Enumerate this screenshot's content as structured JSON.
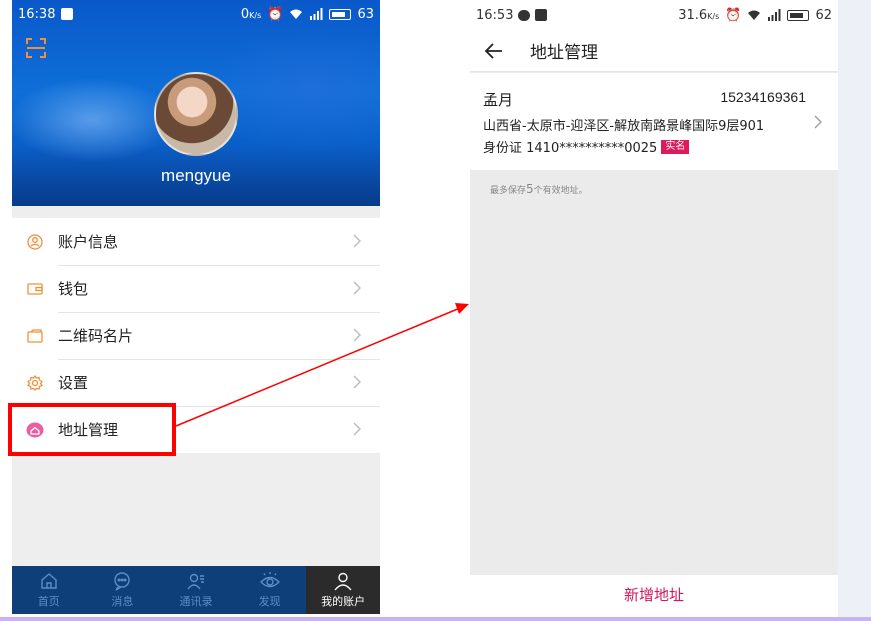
{
  "left_phone": {
    "status": {
      "time": "16:38",
      "net": "0",
      "battery": "63"
    },
    "profile": {
      "username": "mengyue"
    },
    "menu": [
      {
        "label": "账户信息",
        "icon": "person-circle-icon"
      },
      {
        "label": "钱包",
        "icon": "wallet-icon"
      },
      {
        "label": "二维码名片",
        "icon": "qr-card-icon"
      },
      {
        "label": "设置",
        "icon": "gear-icon"
      },
      {
        "label": "地址管理",
        "icon": "address-icon"
      }
    ],
    "tabs": [
      {
        "label": "首页",
        "icon": "home-icon"
      },
      {
        "label": "消息",
        "icon": "chat-icon"
      },
      {
        "label": "通讯录",
        "icon": "contacts-icon"
      },
      {
        "label": "发现",
        "icon": "eye-icon"
      },
      {
        "label": "我的账户",
        "icon": "account-icon",
        "active": true
      }
    ],
    "colors": {
      "hero": "#0a58c9",
      "tabbar": "#0e3f78",
      "highlight": "#ff0000"
    }
  },
  "right_phone": {
    "status": {
      "time": "16:53",
      "net": "31.6",
      "battery": "62"
    },
    "header": {
      "title": "地址管理"
    },
    "address": {
      "name": "孟月",
      "phone": "15234169361",
      "line": "山西省-太原市-迎泽区-解放南路景峰国际9层901",
      "id_label": "身份证 1410**********0025",
      "badge": "实名"
    },
    "hint": {
      "prefix": "最多保存",
      "count": "5",
      "suffix": "个有效地址。"
    },
    "footer": {
      "add_label": "新增地址"
    },
    "colors": {
      "accent": "#d0175c",
      "badge": "#e0195b"
    }
  }
}
